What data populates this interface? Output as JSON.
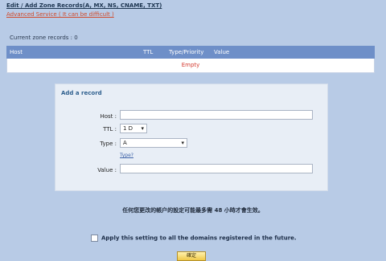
{
  "header": {
    "title": "Edit / Add Zone Records(A, MX, NS, CNAME, TXT)",
    "advanced_link": "Advanced Service ( It can be difficult )"
  },
  "zone": {
    "count_text": "Current zone records : 0"
  },
  "table": {
    "columns": [
      "Host",
      "TTL",
      "Type/Priority",
      "Value"
    ],
    "empty_text": "Empty"
  },
  "add_record": {
    "title": "Add a record",
    "host_label": "Host :",
    "host_value": "",
    "ttl_label": "TTL :",
    "ttl_value": "1 D",
    "type_label": "Type :",
    "type_value": "A",
    "type_help": "Type?",
    "value_label": "Value :",
    "value_value": ""
  },
  "notice_text": "任何您更改的帳户的設定可能最多需 48 小時才會生效。",
  "apply_all_label": "Apply this setting to all the domains registered in the future.",
  "ok_label": "確定",
  "colors": {
    "background": "#b8cbe6",
    "table_header": "#6e8fc8",
    "empty_text": "#d43a2f",
    "link": "#d14a2a"
  }
}
